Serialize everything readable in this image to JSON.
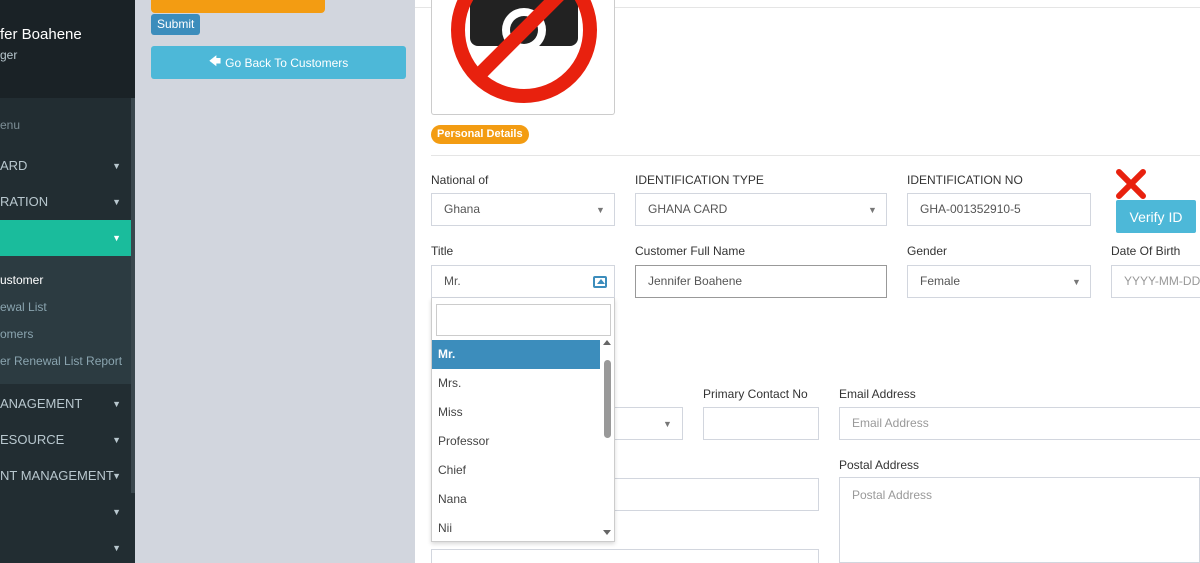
{
  "sidebar": {
    "user_name": "fer Boahene",
    "user_role": "ger",
    "menu_header": "enu",
    "items": [
      {
        "label": "ARD"
      },
      {
        "label": "RATION"
      },
      {
        "label": ""
      },
      {
        "label": "ANAGEMENT"
      },
      {
        "label": "ESOURCE"
      },
      {
        "label": "NT MANAGEMENT"
      },
      {
        "label": ""
      },
      {
        "label": ""
      }
    ],
    "sub_items": [
      {
        "label": "ustomer"
      },
      {
        "label": "ewal List"
      },
      {
        "label": "omers"
      },
      {
        "label": "er Renewal List Report"
      }
    ]
  },
  "left": {
    "submit_label": "Submit",
    "back_label": "Go Back To Customers"
  },
  "form": {
    "badge": "Personal Details",
    "national_label": "National of",
    "national_value": "Ghana",
    "id_type_label": "IDENTIFICATION TYPE",
    "id_type_value": "GHANA CARD",
    "id_no_label": "IDENTIFICATION NO",
    "id_no_value": "GHA-001352910-5",
    "verify_label": "Verify ID",
    "title_label": "Title",
    "title_value": "Mr.",
    "name_label": "Customer Full Name",
    "name_value": "Jennifer Boahene",
    "gender_label": "Gender",
    "gender_value": "Female",
    "dob_label": "Date Of Birth",
    "dob_placeholder": "YYYY-MM-DD",
    "primary_label": "Primary Contact No",
    "email_label": "Email Address",
    "email_placeholder": "Email Address",
    "postal_label": "Postal Address",
    "postal_placeholder": "Postal Address"
  },
  "title_dropdown": {
    "options": [
      "Mr.",
      "Mrs.",
      "Miss",
      "Professor",
      "Chief",
      "Nana",
      "Nii"
    ],
    "selected": "Mr."
  },
  "colors": {
    "accent": "#1abc9c",
    "primary": "#3c8dbc",
    "info": "#4db8d8",
    "warning": "#f39c12",
    "danger": "#e8210e"
  }
}
